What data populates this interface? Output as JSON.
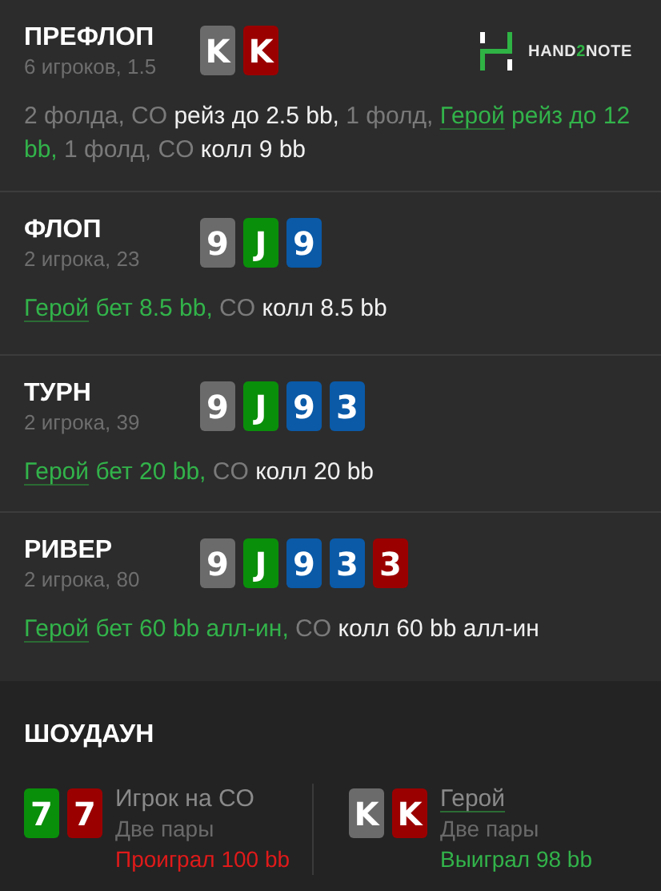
{
  "logo": {
    "text": "HAND**2**NOTE"
  },
  "streets": [
    {
      "title": "ПРЕФЛОП",
      "subtitle": "6 игроков, 1.5",
      "cards": [
        {
          "rank": "K",
          "color": "#6b6b6b"
        },
        {
          "rank": "K",
          "color": "#9b0000"
        }
      ],
      "actions": [
        {
          "kind": "muted",
          "text": "2 фолда, CO "
        },
        {
          "kind": "action",
          "text": "рейз до 2.5 bb,"
        },
        {
          "kind": "muted",
          "text": " 1 фолд, "
        },
        {
          "kind": "hero",
          "text": "Герой"
        },
        {
          "kind": "hero_action",
          "text": " рейз до 12 bb,"
        },
        {
          "kind": "muted",
          "text": " 1 фолд, CO "
        },
        {
          "kind": "action",
          "text": "колл 9 bb"
        }
      ]
    },
    {
      "title": "ФЛОП",
      "subtitle": "2 игрока, 23",
      "cards": [
        {
          "rank": "9",
          "color": "#6b6b6b"
        },
        {
          "rank": "J",
          "color": "#0a8f0a"
        },
        {
          "rank": "9",
          "color": "#0a5aa8"
        }
      ],
      "actions": [
        {
          "kind": "hero",
          "text": "Герой"
        },
        {
          "kind": "hero_action",
          "text": " бет 8.5 bb,"
        },
        {
          "kind": "muted",
          "text": " CO "
        },
        {
          "kind": "action",
          "text": "колл 8.5 bb"
        }
      ]
    },
    {
      "title": "ТУРН",
      "subtitle": "2 игрока, 39",
      "cards": [
        {
          "rank": "9",
          "color": "#6b6b6b"
        },
        {
          "rank": "J",
          "color": "#0a8f0a"
        },
        {
          "rank": "9",
          "color": "#0a5aa8"
        },
        {
          "rank": "3",
          "color": "#0a5aa8"
        }
      ],
      "actions": [
        {
          "kind": "hero",
          "text": "Герой"
        },
        {
          "kind": "hero_action",
          "text": " бет 20 bb,"
        },
        {
          "kind": "muted",
          "text": " CO "
        },
        {
          "kind": "action",
          "text": "колл 20 bb"
        }
      ]
    },
    {
      "title": "РИВЕР",
      "subtitle": "2 игрока, 80",
      "cards": [
        {
          "rank": "9",
          "color": "#6b6b6b"
        },
        {
          "rank": "J",
          "color": "#0a8f0a"
        },
        {
          "rank": "9",
          "color": "#0a5aa8"
        },
        {
          "rank": "3",
          "color": "#0a5aa8"
        },
        {
          "rank": "3",
          "color": "#9b0000"
        }
      ],
      "actions": [
        {
          "kind": "hero",
          "text": "Герой"
        },
        {
          "kind": "hero_action",
          "text": " бет 60 bb алл-ин,"
        },
        {
          "kind": "muted",
          "text": " CO "
        },
        {
          "kind": "action",
          "text": "колл 60 bb алл-ин"
        }
      ]
    }
  ],
  "showdown": {
    "title": "ШОУДАУН",
    "players": [
      {
        "name": "Игрок на CO",
        "hero": false,
        "hand": "Две пары",
        "result": "Проиграл 100 bb",
        "won": false,
        "cards": [
          {
            "rank": "7",
            "color": "#0a8f0a"
          },
          {
            "rank": "7",
            "color": "#9b0000"
          }
        ]
      },
      {
        "name": "Герой",
        "hero": true,
        "hand": "Две пары",
        "result": "Выиграл 98 bb",
        "won": true,
        "cards": [
          {
            "rank": "K",
            "color": "#6b6b6b"
          },
          {
            "rank": "K",
            "color": "#9b0000"
          }
        ]
      }
    ]
  }
}
